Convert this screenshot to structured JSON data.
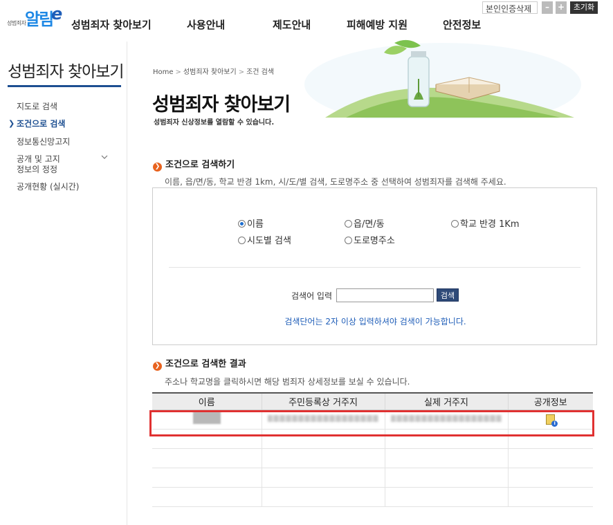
{
  "logo": {
    "tag": "성범죄자",
    "mark": "알림",
    "mark2": "e",
    "dot": "e"
  },
  "gnb": [
    "성범죄자 찾아보기",
    "사용안내",
    "제도안내",
    "피해예방 지원",
    "안전정보"
  ],
  "util": {
    "cert": "본인인증삭제",
    "minus": "–",
    "plus": "+",
    "reset": "초기화"
  },
  "sidebar": {
    "title": "성범죄자 찾아보기",
    "items": [
      {
        "label": "지도로 검색",
        "active": false
      },
      {
        "label": "조건으로 검색",
        "active": true
      },
      {
        "label": "정보통신망고지",
        "active": false
      },
      {
        "label": "공개 및 고지 정보의 정정",
        "active": false
      },
      {
        "label": "공개현황 (실시간)",
        "active": false
      }
    ],
    "item_line1": "공개 및 고지",
    "item_line2": "정보의 정정"
  },
  "breadcrumb": [
    "Home",
    "성범죄자 찾아보기",
    "조건 검색"
  ],
  "page": {
    "title": "성범죄자 찾아보기",
    "desc": "성범죄자 신상정보를 열람할 수 있습니다."
  },
  "search_section": {
    "title": "조건으로 검색하기",
    "desc": "이름, 읍/면/동, 학교 반경 1km, 시/도/별 검색, 도로명주소 중 선택하여 성범죄자를 검색해 주세요.",
    "options": [
      {
        "label": "이름",
        "selected": true
      },
      {
        "label": "읍/면/동",
        "selected": false
      },
      {
        "label": "학교 반경 1Km",
        "selected": false
      },
      {
        "label": "시도별 검색",
        "selected": false
      },
      {
        "label": "도로명주소",
        "selected": false
      }
    ],
    "input_label": "검색어 입력",
    "input_value": "",
    "button": "검색",
    "note": "검색단어는 2자 이상 입력하셔야 검색이 가능합니다."
  },
  "result_section": {
    "title": "조건으로 검색한 결과",
    "desc": "주소나 학교명을 클릭하시면 해당 범죄자 상세정보를 보실 수 있습니다.",
    "columns": [
      "이름",
      "주민등록상 거주지",
      "실제 거주지",
      "공개정보"
    ],
    "empty_rows": 4,
    "icon": "document-info-icon"
  },
  "colors": {
    "accent": "#1d4f91",
    "bullet": "#e8631f",
    "highlight": "#e03131",
    "note": "#1e5db8"
  }
}
